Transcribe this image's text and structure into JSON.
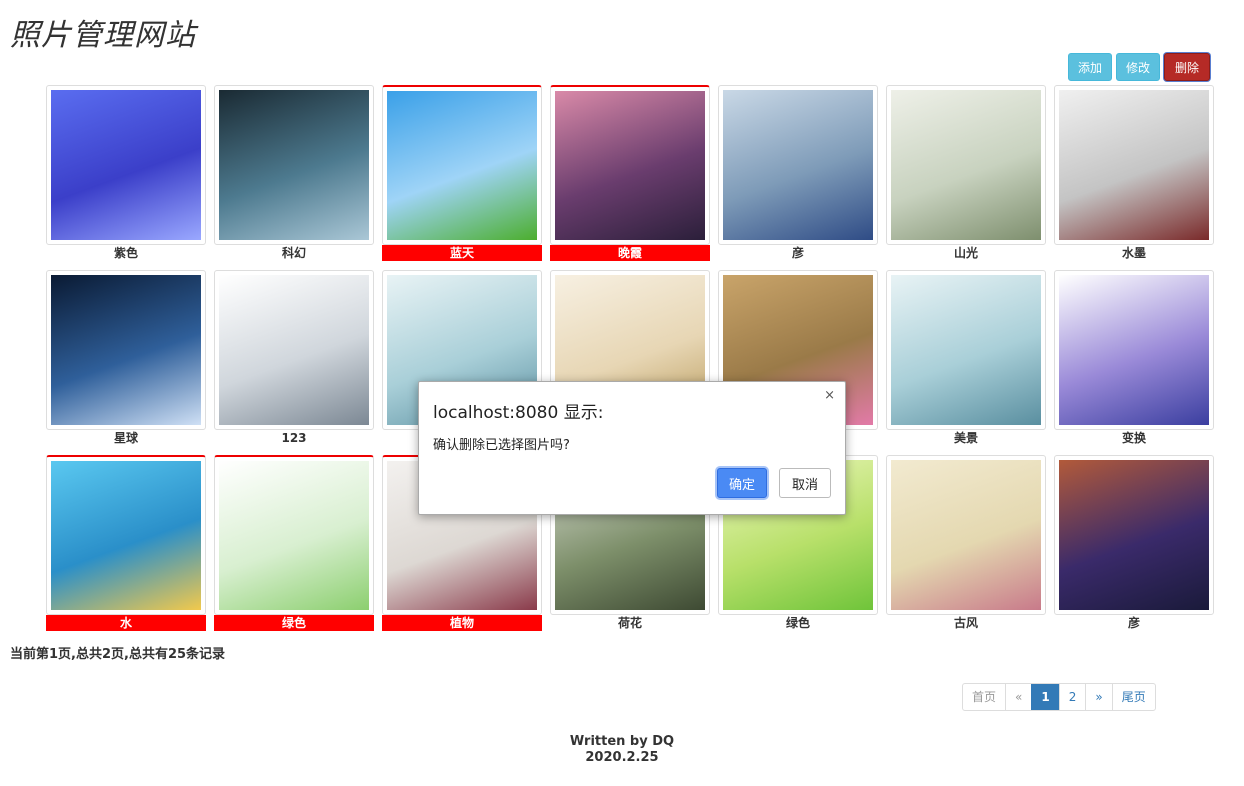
{
  "site": {
    "title": "照片管理网站"
  },
  "toolbar": {
    "add_label": "添加",
    "edit_label": "修改",
    "delete_label": "删除"
  },
  "photos": [
    {
      "caption": "紫色",
      "selected": false,
      "colors": [
        "#5a6df0",
        "#3b3fc9",
        "#9aa8ff"
      ]
    },
    {
      "caption": "科幻",
      "selected": false,
      "colors": [
        "#1a2a33",
        "#4d7a8f",
        "#aac7d6"
      ]
    },
    {
      "caption": "蓝天",
      "selected": true,
      "colors": [
        "#3aa0e8",
        "#9fd4f7",
        "#4cae2e"
      ]
    },
    {
      "caption": "晚霞",
      "selected": true,
      "colors": [
        "#d98aa8",
        "#6a3d6e",
        "#2b1f3a"
      ]
    },
    {
      "caption": "彦",
      "selected": false,
      "colors": [
        "#c9d8e6",
        "#7e9bb8",
        "#2f4c86"
      ]
    },
    {
      "caption": "山光",
      "selected": false,
      "colors": [
        "#eef0e8",
        "#c8d2bf",
        "#7e8f6e"
      ]
    },
    {
      "caption": "水墨",
      "selected": false,
      "colors": [
        "#f0f0f0",
        "#c4c4c4",
        "#7a2a2a"
      ]
    },
    {
      "caption": "星球",
      "selected": false,
      "colors": [
        "#0a1a33",
        "#2f5f9a",
        "#cfe0f5"
      ]
    },
    {
      "caption": "123",
      "selected": false,
      "colors": [
        "#ffffff",
        "#d0d6dc",
        "#7c8894"
      ]
    },
    {
      "caption": "",
      "selected": false,
      "colors": [
        "#e8f3f5",
        "#a9cfd8",
        "#5a8fa0"
      ]
    },
    {
      "caption": "",
      "selected": false,
      "colors": [
        "#f7f0e2",
        "#e7d6b4",
        "#b89a5a"
      ]
    },
    {
      "caption": "",
      "selected": false,
      "colors": [
        "#c9a46a",
        "#9a7a48",
        "#e27aa8"
      ]
    },
    {
      "caption": "美景",
      "selected": false,
      "colors": [
        "#e8f3f5",
        "#a9cfd8",
        "#5a8fa0"
      ]
    },
    {
      "caption": "变换",
      "selected": false,
      "colors": [
        "#ffffff",
        "#9a8ad8",
        "#3b3fa0"
      ]
    },
    {
      "caption": "水",
      "selected": true,
      "colors": [
        "#5ac8f0",
        "#2a8fc9",
        "#f2c94c"
      ]
    },
    {
      "caption": "绿色",
      "selected": true,
      "colors": [
        "#ffffff",
        "#d8efd0",
        "#8ccf6f"
      ]
    },
    {
      "caption": "植物",
      "selected": true,
      "colors": [
        "#f3f1ef",
        "#ddd8d3",
        "#8a3a4a"
      ]
    },
    {
      "caption": "荷花",
      "selected": false,
      "colors": [
        "#d8dcd2",
        "#7d8f6a",
        "#3e4a33"
      ]
    },
    {
      "caption": "绿色",
      "selected": false,
      "colors": [
        "#eef7c0",
        "#b8e06a",
        "#6fc43a"
      ]
    },
    {
      "caption": "古风",
      "selected": false,
      "colors": [
        "#f2ead0",
        "#e4d8b0",
        "#c87a8a"
      ]
    },
    {
      "caption": "彦",
      "selected": false,
      "colors": [
        "#b25a3a",
        "#3a2a6a",
        "#1a1a3a"
      ]
    }
  ],
  "record": {
    "text": "当前第1页,总共2页,总共有25条记录"
  },
  "pagination": {
    "items": [
      "首页",
      "«",
      "1",
      "2",
      "»",
      "尾页"
    ],
    "active": "1"
  },
  "footer": {
    "line1": "Written by DQ",
    "line2": "2020.2.25"
  },
  "dialog": {
    "title": "localhost:8080 显示:",
    "message": "确认删除已选择图片吗?",
    "ok_label": "确定",
    "cancel_label": "取消",
    "close_symbol": "×"
  }
}
